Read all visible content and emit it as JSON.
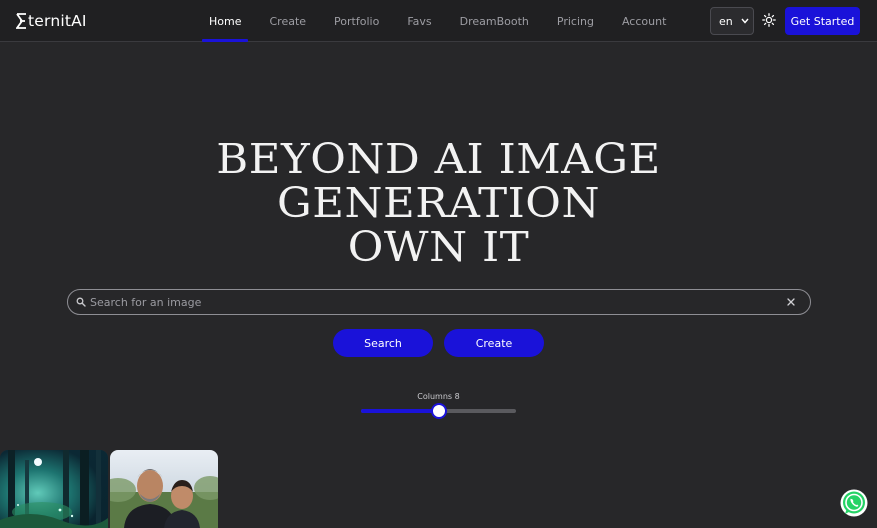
{
  "brand": {
    "name": "ternitAI",
    "accent": "#1a12d9"
  },
  "nav": {
    "items": [
      {
        "label": "Home",
        "active": true
      },
      {
        "label": "Create",
        "active": false
      },
      {
        "label": "Portfolio",
        "active": false
      },
      {
        "label": "Favs",
        "active": false
      },
      {
        "label": "DreamBooth",
        "active": false
      },
      {
        "label": "Pricing",
        "active": false
      },
      {
        "label": "Account",
        "active": false
      }
    ],
    "language": "en",
    "theme_icon": "sun-icon",
    "cta_label": "Get Started"
  },
  "hero": {
    "line1": "BEYOND AI IMAGE",
    "line2": "GENERATION",
    "line3": "OWN IT"
  },
  "search": {
    "placeholder": "Search for an image",
    "value": "",
    "search_label": "Search",
    "create_label": "Create"
  },
  "columns": {
    "label": "Columns 8",
    "value": 8,
    "fraction": 0.5
  },
  "gallery": {
    "items": [
      {
        "subject": "forest-night-image"
      },
      {
        "subject": "portrait-photo-image"
      }
    ]
  },
  "chat_widget": {
    "icon": "whatsapp-icon"
  }
}
